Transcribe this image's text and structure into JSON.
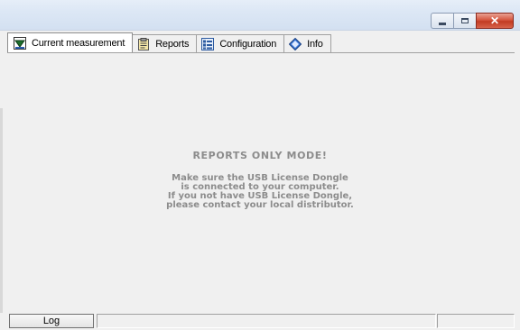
{
  "window": {
    "caption_buttons": [
      "minimize",
      "maximize",
      "close"
    ]
  },
  "tabs": [
    {
      "label": "Current measurement",
      "icon": "measurement-icon",
      "active": true
    },
    {
      "label": "Reports",
      "icon": "reports-icon",
      "active": false
    },
    {
      "label": "Configuration",
      "icon": "configuration-icon",
      "active": false
    },
    {
      "label": "Info",
      "icon": "info-icon",
      "active": false
    }
  ],
  "message": {
    "title": "REPORTS ONLY MODE!",
    "lines": [
      "Make sure the USB License Dongle",
      "is connected to your computer.",
      "If you not have USB License Dongle,",
      "please contact your local distributor."
    ]
  },
  "statusbar": {
    "log_label": "Log",
    "status_text": "",
    "right_text": ""
  },
  "colors": {
    "message_text": "#8c8c8c",
    "titlebar": "#dce7f5",
    "close_button": "#c94a33"
  }
}
